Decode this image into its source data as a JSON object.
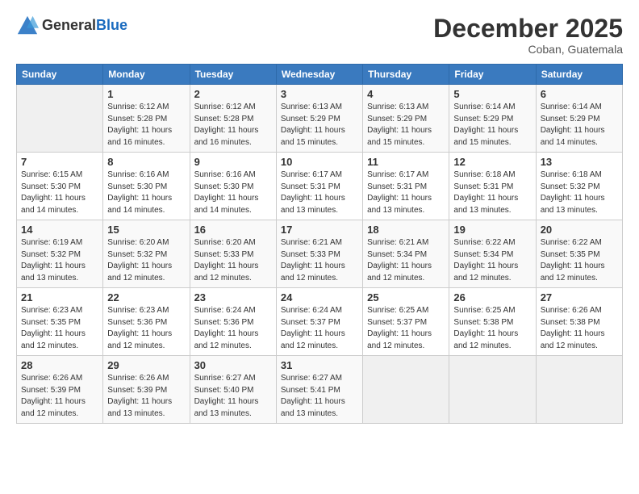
{
  "header": {
    "logo_line1": "General",
    "logo_line2": "Blue",
    "month": "December 2025",
    "location": "Coban, Guatemala"
  },
  "weekdays": [
    "Sunday",
    "Monday",
    "Tuesday",
    "Wednesday",
    "Thursday",
    "Friday",
    "Saturday"
  ],
  "weeks": [
    [
      {
        "day": "",
        "info": ""
      },
      {
        "day": "1",
        "info": "Sunrise: 6:12 AM\nSunset: 5:28 PM\nDaylight: 11 hours\nand 16 minutes."
      },
      {
        "day": "2",
        "info": "Sunrise: 6:12 AM\nSunset: 5:28 PM\nDaylight: 11 hours\nand 16 minutes."
      },
      {
        "day": "3",
        "info": "Sunrise: 6:13 AM\nSunset: 5:29 PM\nDaylight: 11 hours\nand 15 minutes."
      },
      {
        "day": "4",
        "info": "Sunrise: 6:13 AM\nSunset: 5:29 PM\nDaylight: 11 hours\nand 15 minutes."
      },
      {
        "day": "5",
        "info": "Sunrise: 6:14 AM\nSunset: 5:29 PM\nDaylight: 11 hours\nand 15 minutes."
      },
      {
        "day": "6",
        "info": "Sunrise: 6:14 AM\nSunset: 5:29 PM\nDaylight: 11 hours\nand 14 minutes."
      }
    ],
    [
      {
        "day": "7",
        "info": "Sunrise: 6:15 AM\nSunset: 5:30 PM\nDaylight: 11 hours\nand 14 minutes."
      },
      {
        "day": "8",
        "info": "Sunrise: 6:16 AM\nSunset: 5:30 PM\nDaylight: 11 hours\nand 14 minutes."
      },
      {
        "day": "9",
        "info": "Sunrise: 6:16 AM\nSunset: 5:30 PM\nDaylight: 11 hours\nand 14 minutes."
      },
      {
        "day": "10",
        "info": "Sunrise: 6:17 AM\nSunset: 5:31 PM\nDaylight: 11 hours\nand 13 minutes."
      },
      {
        "day": "11",
        "info": "Sunrise: 6:17 AM\nSunset: 5:31 PM\nDaylight: 11 hours\nand 13 minutes."
      },
      {
        "day": "12",
        "info": "Sunrise: 6:18 AM\nSunset: 5:31 PM\nDaylight: 11 hours\nand 13 minutes."
      },
      {
        "day": "13",
        "info": "Sunrise: 6:18 AM\nSunset: 5:32 PM\nDaylight: 11 hours\nand 13 minutes."
      }
    ],
    [
      {
        "day": "14",
        "info": "Sunrise: 6:19 AM\nSunset: 5:32 PM\nDaylight: 11 hours\nand 13 minutes."
      },
      {
        "day": "15",
        "info": "Sunrise: 6:20 AM\nSunset: 5:32 PM\nDaylight: 11 hours\nand 12 minutes."
      },
      {
        "day": "16",
        "info": "Sunrise: 6:20 AM\nSunset: 5:33 PM\nDaylight: 11 hours\nand 12 minutes."
      },
      {
        "day": "17",
        "info": "Sunrise: 6:21 AM\nSunset: 5:33 PM\nDaylight: 11 hours\nand 12 minutes."
      },
      {
        "day": "18",
        "info": "Sunrise: 6:21 AM\nSunset: 5:34 PM\nDaylight: 11 hours\nand 12 minutes."
      },
      {
        "day": "19",
        "info": "Sunrise: 6:22 AM\nSunset: 5:34 PM\nDaylight: 11 hours\nand 12 minutes."
      },
      {
        "day": "20",
        "info": "Sunrise: 6:22 AM\nSunset: 5:35 PM\nDaylight: 11 hours\nand 12 minutes."
      }
    ],
    [
      {
        "day": "21",
        "info": "Sunrise: 6:23 AM\nSunset: 5:35 PM\nDaylight: 11 hours\nand 12 minutes."
      },
      {
        "day": "22",
        "info": "Sunrise: 6:23 AM\nSunset: 5:36 PM\nDaylight: 11 hours\nand 12 minutes."
      },
      {
        "day": "23",
        "info": "Sunrise: 6:24 AM\nSunset: 5:36 PM\nDaylight: 11 hours\nand 12 minutes."
      },
      {
        "day": "24",
        "info": "Sunrise: 6:24 AM\nSunset: 5:37 PM\nDaylight: 11 hours\nand 12 minutes."
      },
      {
        "day": "25",
        "info": "Sunrise: 6:25 AM\nSunset: 5:37 PM\nDaylight: 11 hours\nand 12 minutes."
      },
      {
        "day": "26",
        "info": "Sunrise: 6:25 AM\nSunset: 5:38 PM\nDaylight: 11 hours\nand 12 minutes."
      },
      {
        "day": "27",
        "info": "Sunrise: 6:26 AM\nSunset: 5:38 PM\nDaylight: 11 hours\nand 12 minutes."
      }
    ],
    [
      {
        "day": "28",
        "info": "Sunrise: 6:26 AM\nSunset: 5:39 PM\nDaylight: 11 hours\nand 12 minutes."
      },
      {
        "day": "29",
        "info": "Sunrise: 6:26 AM\nSunset: 5:39 PM\nDaylight: 11 hours\nand 13 minutes."
      },
      {
        "day": "30",
        "info": "Sunrise: 6:27 AM\nSunset: 5:40 PM\nDaylight: 11 hours\nand 13 minutes."
      },
      {
        "day": "31",
        "info": "Sunrise: 6:27 AM\nSunset: 5:41 PM\nDaylight: 11 hours\nand 13 minutes."
      },
      {
        "day": "",
        "info": ""
      },
      {
        "day": "",
        "info": ""
      },
      {
        "day": "",
        "info": ""
      }
    ]
  ]
}
